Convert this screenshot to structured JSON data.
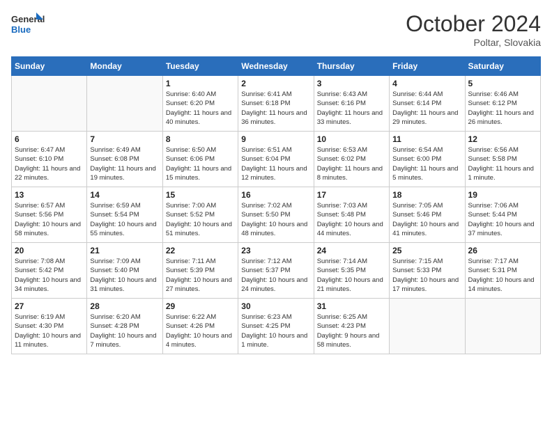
{
  "header": {
    "logo_line1": "General",
    "logo_line2": "Blue",
    "month_title": "October 2024",
    "location": "Poltar, Slovakia"
  },
  "days_of_week": [
    "Sunday",
    "Monday",
    "Tuesday",
    "Wednesday",
    "Thursday",
    "Friday",
    "Saturday"
  ],
  "weeks": [
    [
      {
        "day": "",
        "info": ""
      },
      {
        "day": "",
        "info": ""
      },
      {
        "day": "1",
        "info": "Sunrise: 6:40 AM\nSunset: 6:20 PM\nDaylight: 11 hours and 40 minutes."
      },
      {
        "day": "2",
        "info": "Sunrise: 6:41 AM\nSunset: 6:18 PM\nDaylight: 11 hours and 36 minutes."
      },
      {
        "day": "3",
        "info": "Sunrise: 6:43 AM\nSunset: 6:16 PM\nDaylight: 11 hours and 33 minutes."
      },
      {
        "day": "4",
        "info": "Sunrise: 6:44 AM\nSunset: 6:14 PM\nDaylight: 11 hours and 29 minutes."
      },
      {
        "day": "5",
        "info": "Sunrise: 6:46 AM\nSunset: 6:12 PM\nDaylight: 11 hours and 26 minutes."
      }
    ],
    [
      {
        "day": "6",
        "info": "Sunrise: 6:47 AM\nSunset: 6:10 PM\nDaylight: 11 hours and 22 minutes."
      },
      {
        "day": "7",
        "info": "Sunrise: 6:49 AM\nSunset: 6:08 PM\nDaylight: 11 hours and 19 minutes."
      },
      {
        "day": "8",
        "info": "Sunrise: 6:50 AM\nSunset: 6:06 PM\nDaylight: 11 hours and 15 minutes."
      },
      {
        "day": "9",
        "info": "Sunrise: 6:51 AM\nSunset: 6:04 PM\nDaylight: 11 hours and 12 minutes."
      },
      {
        "day": "10",
        "info": "Sunrise: 6:53 AM\nSunset: 6:02 PM\nDaylight: 11 hours and 8 minutes."
      },
      {
        "day": "11",
        "info": "Sunrise: 6:54 AM\nSunset: 6:00 PM\nDaylight: 11 hours and 5 minutes."
      },
      {
        "day": "12",
        "info": "Sunrise: 6:56 AM\nSunset: 5:58 PM\nDaylight: 11 hours and 1 minute."
      }
    ],
    [
      {
        "day": "13",
        "info": "Sunrise: 6:57 AM\nSunset: 5:56 PM\nDaylight: 10 hours and 58 minutes."
      },
      {
        "day": "14",
        "info": "Sunrise: 6:59 AM\nSunset: 5:54 PM\nDaylight: 10 hours and 55 minutes."
      },
      {
        "day": "15",
        "info": "Sunrise: 7:00 AM\nSunset: 5:52 PM\nDaylight: 10 hours and 51 minutes."
      },
      {
        "day": "16",
        "info": "Sunrise: 7:02 AM\nSunset: 5:50 PM\nDaylight: 10 hours and 48 minutes."
      },
      {
        "day": "17",
        "info": "Sunrise: 7:03 AM\nSunset: 5:48 PM\nDaylight: 10 hours and 44 minutes."
      },
      {
        "day": "18",
        "info": "Sunrise: 7:05 AM\nSunset: 5:46 PM\nDaylight: 10 hours and 41 minutes."
      },
      {
        "day": "19",
        "info": "Sunrise: 7:06 AM\nSunset: 5:44 PM\nDaylight: 10 hours and 37 minutes."
      }
    ],
    [
      {
        "day": "20",
        "info": "Sunrise: 7:08 AM\nSunset: 5:42 PM\nDaylight: 10 hours and 34 minutes."
      },
      {
        "day": "21",
        "info": "Sunrise: 7:09 AM\nSunset: 5:40 PM\nDaylight: 10 hours and 31 minutes."
      },
      {
        "day": "22",
        "info": "Sunrise: 7:11 AM\nSunset: 5:39 PM\nDaylight: 10 hours and 27 minutes."
      },
      {
        "day": "23",
        "info": "Sunrise: 7:12 AM\nSunset: 5:37 PM\nDaylight: 10 hours and 24 minutes."
      },
      {
        "day": "24",
        "info": "Sunrise: 7:14 AM\nSunset: 5:35 PM\nDaylight: 10 hours and 21 minutes."
      },
      {
        "day": "25",
        "info": "Sunrise: 7:15 AM\nSunset: 5:33 PM\nDaylight: 10 hours and 17 minutes."
      },
      {
        "day": "26",
        "info": "Sunrise: 7:17 AM\nSunset: 5:31 PM\nDaylight: 10 hours and 14 minutes."
      }
    ],
    [
      {
        "day": "27",
        "info": "Sunrise: 6:19 AM\nSunset: 4:30 PM\nDaylight: 10 hours and 11 minutes."
      },
      {
        "day": "28",
        "info": "Sunrise: 6:20 AM\nSunset: 4:28 PM\nDaylight: 10 hours and 7 minutes."
      },
      {
        "day": "29",
        "info": "Sunrise: 6:22 AM\nSunset: 4:26 PM\nDaylight: 10 hours and 4 minutes."
      },
      {
        "day": "30",
        "info": "Sunrise: 6:23 AM\nSunset: 4:25 PM\nDaylight: 10 hours and 1 minute."
      },
      {
        "day": "31",
        "info": "Sunrise: 6:25 AM\nSunset: 4:23 PM\nDaylight: 9 hours and 58 minutes."
      },
      {
        "day": "",
        "info": ""
      },
      {
        "day": "",
        "info": ""
      }
    ]
  ]
}
